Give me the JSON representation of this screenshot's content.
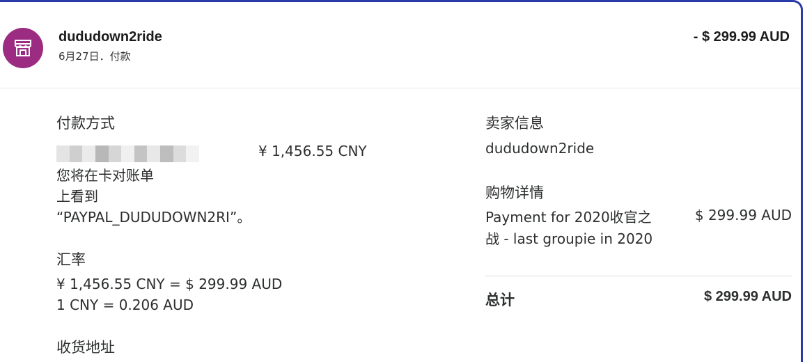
{
  "header": {
    "merchant_name": "dududown2ride",
    "meta": "6月27日．付款",
    "amount": "- $ 299.99 AUD",
    "avatar_icon": "store-icon",
    "avatar_color": "#9b2c82"
  },
  "payment": {
    "title": "付款方式",
    "cny_amount": "¥ 1,456.55 CNY",
    "notice_line1": "您将在卡对账单",
    "notice_line2": "上看到",
    "notice_line3": "“PAYPAL_DUDUDOWN2RI”。"
  },
  "exchange": {
    "title": "汇率",
    "line1": "¥ 1,456.55 CNY = $ 299.99 AUD",
    "line2": "1 CNY = 0.206 AUD"
  },
  "shipping": {
    "title": "收货地址"
  },
  "seller": {
    "title": "卖家信息",
    "name": "dududown2ride"
  },
  "purchase": {
    "title": "购物详情",
    "item_line1": "Payment for 2020收官之",
    "item_line2": "战 - last groupie in 2020",
    "item_price": "$ 299.99 AUD"
  },
  "total": {
    "label": "总计",
    "amount": "$ 299.99 AUD"
  },
  "colors": {
    "accent_border": "#2a3aa8"
  }
}
